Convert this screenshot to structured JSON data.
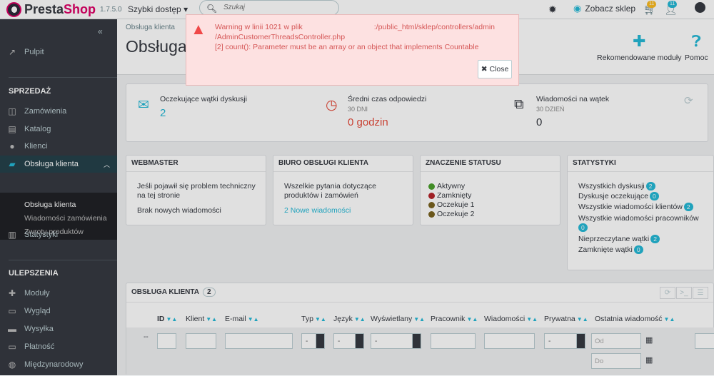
{
  "topbar": {
    "logo_a": "Presta",
    "logo_b": "Shop",
    "version": "1.7.5.0",
    "quick_access": "Szybki dostęp",
    "search_placeholder": "Szukaj",
    "view_shop": "Zobacz sklep",
    "orders_badge": "11",
    "customers_badge": "11"
  },
  "sidebar": {
    "dashboard": "Pulpit",
    "section_sell": "SPRZEDAŻ",
    "orders": "Zamówienia",
    "catalog": "Katalog",
    "customers": "Klienci",
    "customer_service": "Obsługa klienta",
    "sub": [
      "Obsługa klienta",
      "Wiadomości zamówienia",
      "Zwroty produktów"
    ],
    "stats": "Statystyki",
    "section_improve": "ULEPSZENIA",
    "modules": "Moduły",
    "design": "Wygląd",
    "shipping": "Wysyłka",
    "payment": "Płatność",
    "international": "Międzynarodowy"
  },
  "header": {
    "breadcrumb": "Obsługa klienta",
    "title": "Obsługa klienta",
    "btn_modules": "Rekomendowane moduły",
    "btn_help": "Pomoc"
  },
  "alert": {
    "line1": "Warning w linii 1021 w plik",
    "line1_path": ":/public_html/sklep/controllers/admin",
    "line2": "/AdminCustomerThreadsController.php",
    "line3": "[2] count(): Parameter must be an array or an object that implements Countable",
    "close": "Close"
  },
  "kpis": [
    {
      "label": "Oczekujące wątki dyskusji",
      "sub": "",
      "value": "2",
      "color": "#25b9d7"
    },
    {
      "label": "Średni czas odpowiedzi",
      "sub": "30 DNI",
      "value": "0 godzin",
      "color": "#e54c3c"
    },
    {
      "label": "Wiadomości na wątek",
      "sub": "30 DZIEŃ",
      "value": "0",
      "color": "#363a41"
    }
  ],
  "webmaster": {
    "title": "WEBMASTER",
    "text": "Jeśli pojawił się problem techniczny na tej stronie",
    "status": "Brak nowych wiadomości"
  },
  "service": {
    "title": "BIURO OBSŁUGI KLIENTA",
    "text": "Wszelkie pytania dotyczące produktów i zamówień",
    "link": "2 Nowe wiadomości"
  },
  "status": {
    "title": "ZNACZENIE STATUSU",
    "items": [
      {
        "label": "Aktywny",
        "color": "#4aa02c"
      },
      {
        "label": "Zamknięty",
        "color": "#b5252b"
      },
      {
        "label": "Oczekuje 1",
        "color": "#7a6320"
      },
      {
        "label": "Oczekuje 2",
        "color": "#7a6320"
      }
    ]
  },
  "stats": {
    "title": "STATYSTYKI",
    "rows": [
      {
        "label": "Wszystkich dyskusji",
        "count": "2"
      },
      {
        "label": "Dyskusje oczekujące",
        "count": "0"
      },
      {
        "label": "Wszystkie wiadomości klientów",
        "count": "2"
      },
      {
        "label": "Wszystkie wiadomości pracowników",
        "count": "0"
      },
      {
        "label": "Nieprzeczytane wątki",
        "count": "2"
      },
      {
        "label": "Zamknięte wątki",
        "count": "0"
      }
    ]
  },
  "table": {
    "title": "OBSŁUGA KLIENTA",
    "count": "2",
    "columns": [
      "ID",
      "Klient",
      "E-mail",
      "Typ",
      "Język",
      "Wyświetlany",
      "Pracownik",
      "Wiadomości",
      "Prywatna",
      "Ostatnia wiadomość"
    ],
    "filter_dash": "--",
    "select_value": "-",
    "date_from": "Od",
    "date_to": "Do"
  }
}
